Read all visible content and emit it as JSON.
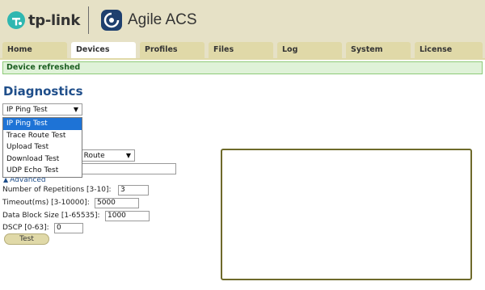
{
  "header": {
    "brand": "tp-link",
    "product": "Agile ACS"
  },
  "tabs": [
    {
      "label": "Home"
    },
    {
      "label": "Devices",
      "active": true
    },
    {
      "label": "Profiles"
    },
    {
      "label": "Files"
    },
    {
      "label": "Log"
    },
    {
      "label": "System"
    },
    {
      "label": "License"
    }
  ],
  "notice": "Device refreshed",
  "page_title": "Diagnostics",
  "test_select": {
    "value": "IP Ping Test",
    "options": [
      "IP Ping Test",
      "Trace Route Test",
      "Upload Test",
      "Download Test",
      "UDP Echo Test"
    ]
  },
  "interface_select": {
    "value_partial": "ult Route"
  },
  "advanced_label": "Advanced",
  "fields": {
    "repetitions": {
      "label": "Number of Repetitions [3-10]:",
      "value": "3"
    },
    "timeout": {
      "label": "Timeout(ms) [3-10000]:",
      "value": "5000"
    },
    "block_size": {
      "label": "Data Block Size [1-65535]:",
      "value": "1000"
    },
    "dscp": {
      "label": "DSCP [0-63]:",
      "value": "0"
    }
  },
  "test_button": "Test",
  "colors": {
    "header_bg": "#e6e1c6",
    "tab_bg": "#e0d9a8",
    "title_blue": "#1f4e8a",
    "notice_green": "#1b5e20",
    "selected_blue": "#1e73d6"
  }
}
